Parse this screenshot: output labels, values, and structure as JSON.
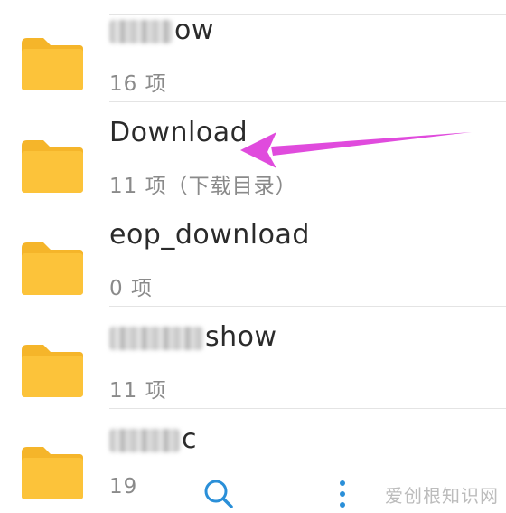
{
  "colors": {
    "folder": "#FCC33A",
    "folder_tab": "#F5B52A",
    "arrow": "#E04BDD",
    "accent": "#2A8FD8"
  },
  "files": [
    {
      "name_suffix": "ow",
      "meta": "16 项",
      "icon": "folder-icon"
    },
    {
      "name": "Download",
      "meta": "11 项（下载目录）",
      "icon": "folder-icon"
    },
    {
      "name": "eop_download",
      "meta": "0 项",
      "icon": "folder-icon"
    },
    {
      "name_suffix": "show",
      "meta": "11 项",
      "icon": "folder-icon"
    },
    {
      "name_suffix": "c",
      "meta": "19",
      "icon": "folder-icon"
    }
  ],
  "bottom_bar": {
    "search_icon": "search-icon",
    "more_icon": "more-vertical-icon"
  },
  "watermark": "爱创根知识网"
}
